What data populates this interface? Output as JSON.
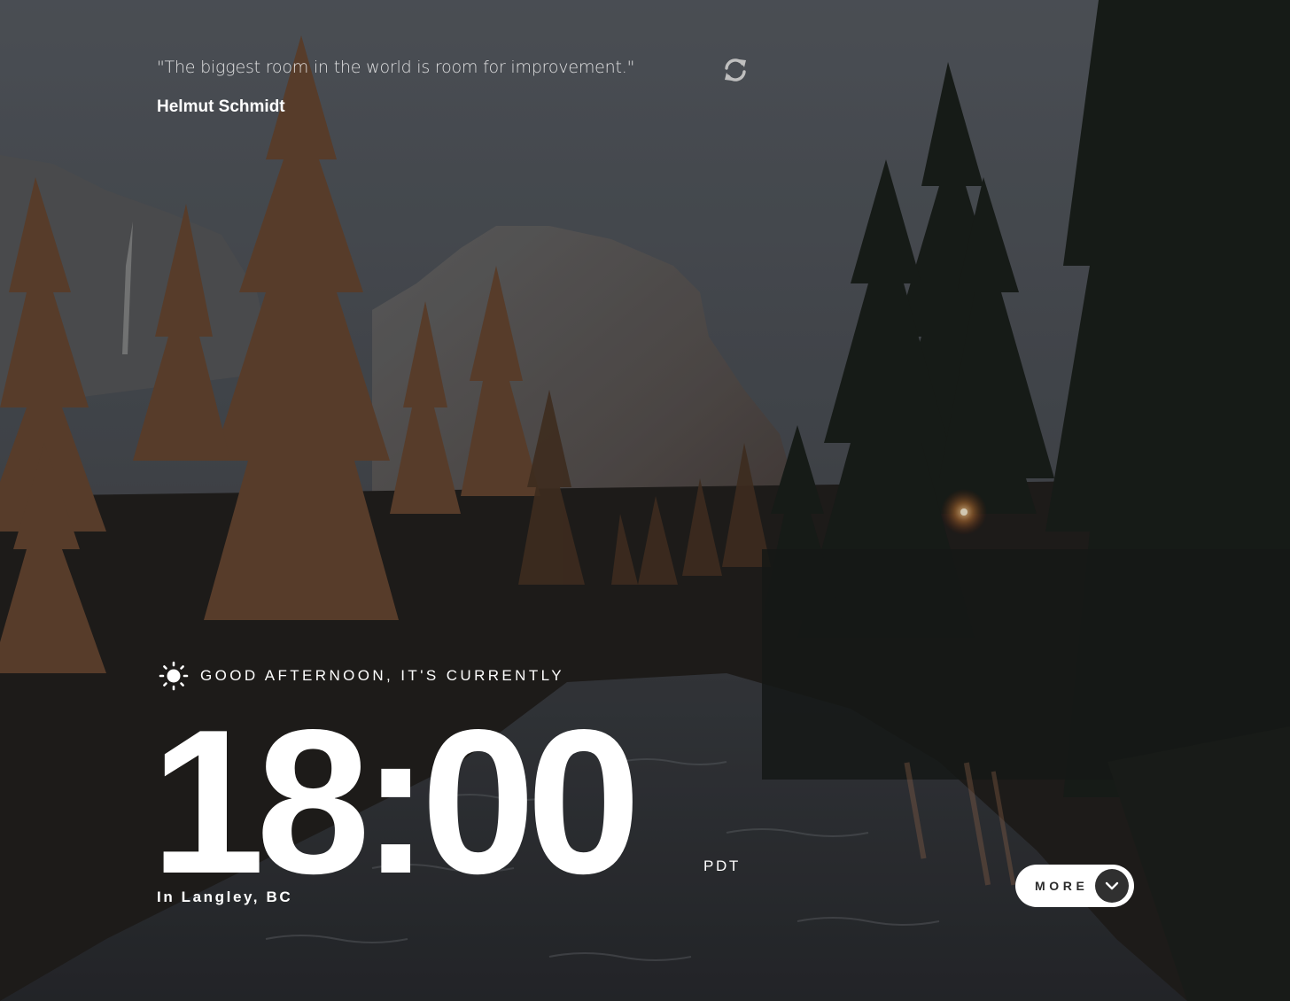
{
  "quote": {
    "text": "\"The biggest room in the world is room for improvement.\"",
    "author": "Helmut Schmidt"
  },
  "refresh_icon": "refresh-icon",
  "greeting": {
    "icon": "sun-icon",
    "text": "GOOD AFTERNOON, IT'S CURRENTLY"
  },
  "clock": {
    "time": "18:00",
    "timezone": "PDT",
    "location": "In Langley, BC"
  },
  "more_button": {
    "label": "MORE",
    "icon": "chevron-down-icon"
  },
  "colors": {
    "text": "#ffffff",
    "button_bg": "#ffffff",
    "button_text": "#2b2b2b",
    "arrow_bg": "#303030"
  }
}
